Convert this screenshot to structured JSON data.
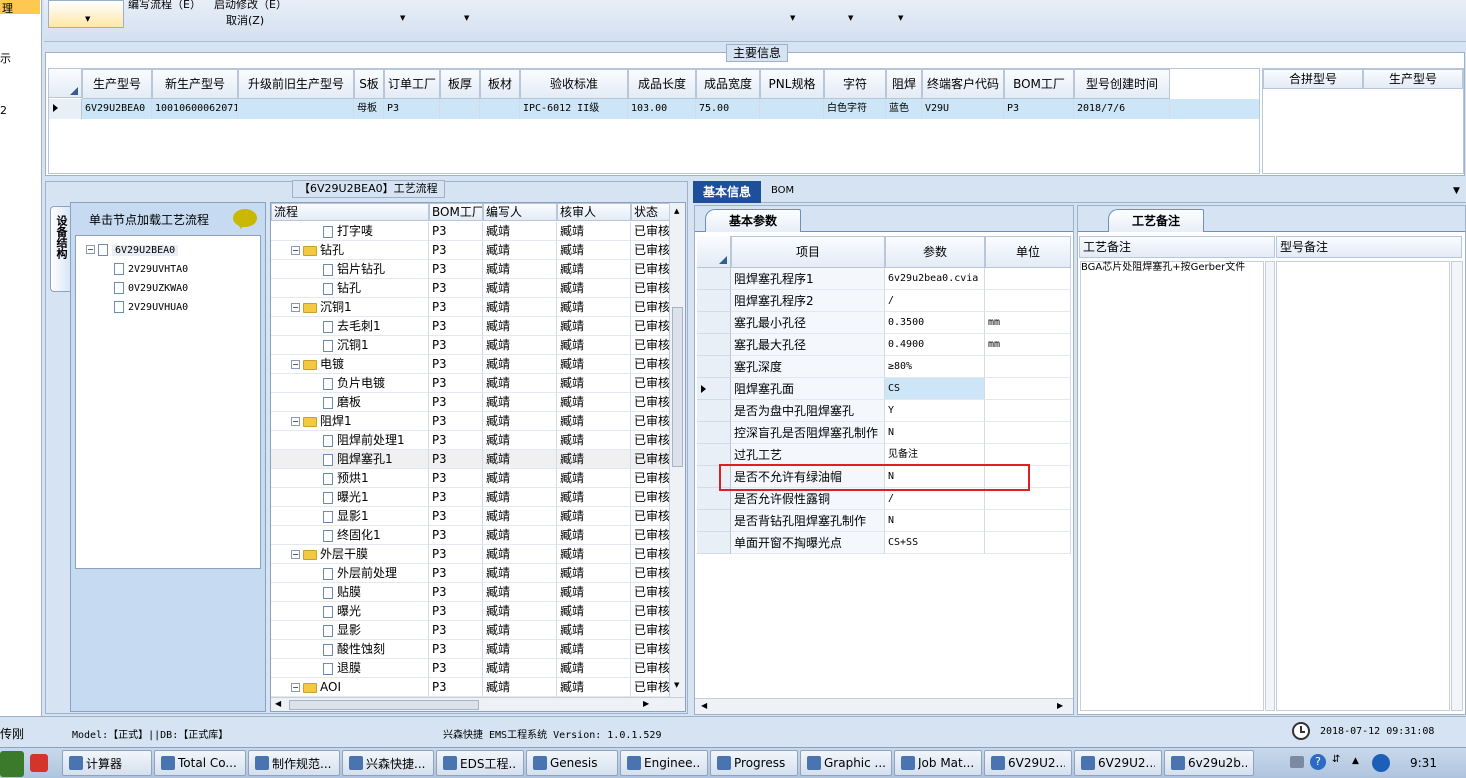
{
  "toolbar": {
    "menu1": "编写流程（E）",
    "menu2": "启动修改（E）",
    "menu3": "取消(Z)",
    "left_label_top": "理",
    "left_label_a": "示",
    "left_label_b": "2"
  },
  "main_info": {
    "title": "主要信息",
    "columns": [
      "生产型号",
      "新生产型号",
      "升级前旧生产型号",
      "S板",
      "订单工厂",
      "板厚",
      "板材",
      "验收标准",
      "成品长度",
      "成品宽度",
      "PNL规格",
      "字符",
      "阻焊",
      "终端客户代码",
      "BOM工厂",
      "型号创建时间"
    ],
    "row": [
      "6V29U2BEA0",
      "10010600062071",
      "",
      "母板",
      "P3",
      "",
      "",
      "IPC-6012 II级",
      "103.00",
      "75.00",
      "",
      "白色字符",
      "蓝色",
      "V29U",
      "P3",
      "2018/7/6"
    ],
    "side_columns": [
      "合拼型号",
      "生产型号"
    ]
  },
  "process_panel": {
    "title": "【6V29U2BEA0】工艺流程",
    "vertical_tab": "设备结构",
    "load_hint": "单击节点加载工艺流程",
    "tree_root": "6V29U2BEA0",
    "tree_children": [
      "2V29UVHTA0",
      "0V29UZKWA0",
      "2V29UVHUA0"
    ],
    "columns": [
      "流程",
      "BOM工厂",
      "编写人",
      "核审人",
      "状态"
    ],
    "rows": [
      {
        "name": "打字唛",
        "level": 2,
        "folder": false,
        "bom": "P3",
        "writer": "臧靖",
        "checker": "臧靖",
        "status": "已审核"
      },
      {
        "name": "钻孔",
        "level": 1,
        "folder": true,
        "bom": "P3",
        "writer": "臧靖",
        "checker": "臧靖",
        "status": "已审核"
      },
      {
        "name": "铝片钻孔",
        "level": 2,
        "folder": false,
        "bom": "P3",
        "writer": "臧靖",
        "checker": "臧靖",
        "status": "已审核"
      },
      {
        "name": "钻孔",
        "level": 2,
        "folder": false,
        "bom": "P3",
        "writer": "臧靖",
        "checker": "臧靖",
        "status": "已审核"
      },
      {
        "name": "沉铜1",
        "level": 1,
        "folder": true,
        "bom": "P3",
        "writer": "臧靖",
        "checker": "臧靖",
        "status": "已审核"
      },
      {
        "name": "去毛刺1",
        "level": 2,
        "folder": false,
        "bom": "P3",
        "writer": "臧靖",
        "checker": "臧靖",
        "status": "已审核"
      },
      {
        "name": "沉铜1",
        "level": 2,
        "folder": false,
        "bom": "P3",
        "writer": "臧靖",
        "checker": "臧靖",
        "status": "已审核"
      },
      {
        "name": "电镀",
        "level": 1,
        "folder": true,
        "bom": "P3",
        "writer": "臧靖",
        "checker": "臧靖",
        "status": "已审核"
      },
      {
        "name": "负片电镀",
        "level": 2,
        "folder": false,
        "bom": "P3",
        "writer": "臧靖",
        "checker": "臧靖",
        "status": "已审核"
      },
      {
        "name": "磨板",
        "level": 2,
        "folder": false,
        "bom": "P3",
        "writer": "臧靖",
        "checker": "臧靖",
        "status": "已审核"
      },
      {
        "name": "阻焊1",
        "level": 1,
        "folder": true,
        "bom": "P3",
        "writer": "臧靖",
        "checker": "臧靖",
        "status": "已审核"
      },
      {
        "name": "阻焊前处理1",
        "level": 2,
        "folder": false,
        "bom": "P3",
        "writer": "臧靖",
        "checker": "臧靖",
        "status": "已审核"
      },
      {
        "name": "阻焊塞孔1",
        "level": 2,
        "folder": false,
        "bom": "P3",
        "writer": "臧靖",
        "checker": "臧靖",
        "status": "已审核",
        "selected": true
      },
      {
        "name": "预烘1",
        "level": 2,
        "folder": false,
        "bom": "P3",
        "writer": "臧靖",
        "checker": "臧靖",
        "status": "已审核"
      },
      {
        "name": "曝光1",
        "level": 2,
        "folder": false,
        "bom": "P3",
        "writer": "臧靖",
        "checker": "臧靖",
        "status": "已审核"
      },
      {
        "name": "显影1",
        "level": 2,
        "folder": false,
        "bom": "P3",
        "writer": "臧靖",
        "checker": "臧靖",
        "status": "已审核"
      },
      {
        "name": "终固化1",
        "level": 2,
        "folder": false,
        "bom": "P3",
        "writer": "臧靖",
        "checker": "臧靖",
        "status": "已审核"
      },
      {
        "name": "外层干膜",
        "level": 1,
        "folder": true,
        "bom": "P3",
        "writer": "臧靖",
        "checker": "臧靖",
        "status": "已审核"
      },
      {
        "name": "外层前处理",
        "level": 2,
        "folder": false,
        "bom": "P3",
        "writer": "臧靖",
        "checker": "臧靖",
        "status": "已审核"
      },
      {
        "name": "贴膜",
        "level": 2,
        "folder": false,
        "bom": "P3",
        "writer": "臧靖",
        "checker": "臧靖",
        "status": "已审核"
      },
      {
        "name": "曝光",
        "level": 2,
        "folder": false,
        "bom": "P3",
        "writer": "臧靖",
        "checker": "臧靖",
        "status": "已审核"
      },
      {
        "name": "显影",
        "level": 2,
        "folder": false,
        "bom": "P3",
        "writer": "臧靖",
        "checker": "臧靖",
        "status": "已审核"
      },
      {
        "name": "酸性蚀刻",
        "level": 2,
        "folder": false,
        "bom": "P3",
        "writer": "臧靖",
        "checker": "臧靖",
        "status": "已审核"
      },
      {
        "name": "退膜",
        "level": 2,
        "folder": false,
        "bom": "P3",
        "writer": "臧靖",
        "checker": "臧靖",
        "status": "已审核"
      },
      {
        "name": "AOI",
        "level": 1,
        "folder": true,
        "bom": "P3",
        "writer": "臧靖",
        "checker": "臧靖",
        "status": "已审核"
      }
    ]
  },
  "basic_panel": {
    "tabs": [
      "基本信息",
      "BOM"
    ],
    "subtab": "基本参数",
    "columns": [
      "项目",
      "参数",
      "单位"
    ],
    "rows": [
      {
        "item": "阻焊塞孔程序1",
        "value": "6v29u2bea0.cvia",
        "unit": ""
      },
      {
        "item": "阻焊塞孔程序2",
        "value": "/",
        "unit": ""
      },
      {
        "item": "塞孔最小孔径",
        "value": "0.3500",
        "unit": "mm"
      },
      {
        "item": "塞孔最大孔径",
        "value": "0.4900",
        "unit": "mm"
      },
      {
        "item": "塞孔深度",
        "value": "≥80%",
        "unit": ""
      },
      {
        "item": "阻焊塞孔面",
        "value": "CS",
        "unit": "",
        "current": true
      },
      {
        "item": "是否为盘中孔阻焊塞孔",
        "value": "Y",
        "unit": ""
      },
      {
        "item": "控深盲孔是否阻焊塞孔制作",
        "value": "N",
        "unit": ""
      },
      {
        "item": "过孔工艺",
        "value": "见备注",
        "unit": ""
      },
      {
        "item": "是否不允许有绿油帽",
        "value": "N",
        "unit": "",
        "highlight": true
      },
      {
        "item": "是否允许假性露铜",
        "value": "/",
        "unit": ""
      },
      {
        "item": "是否背钻孔阻焊塞孔制作",
        "value": "N",
        "unit": ""
      },
      {
        "item": "单面开窗不掏曝光点",
        "value": "CS+SS",
        "unit": ""
      }
    ]
  },
  "remark_panel": {
    "tab": "工艺备注",
    "columns": [
      "工艺备注",
      "型号备注"
    ],
    "process_remark": "BGA芯片处阻焊塞孔+按Gerber文件",
    "model_remark": ""
  },
  "status_bar": {
    "user": "传刚",
    "model": "Model:【正式】||DB:【正式库】",
    "system": "兴森快捷 EMS工程系统 Version: 1.0.1.529",
    "datetime": "2018-07-12 09:31:08"
  },
  "taskbar": {
    "items": [
      "计算器",
      "Total Co...",
      "制作规范...",
      "兴森快捷...",
      "EDS工程...",
      "Genesis",
      "Enginee...",
      "Progress",
      "Graphic ...",
      "Job Mat...",
      "6V29U2...",
      "6V29U2...",
      "6v29u2b..."
    ],
    "clock": "9:31"
  },
  "colors": {
    "selected_row": "#cde6f7",
    "highlight_box": "#e02020",
    "tab_active": "#1e4f9c"
  }
}
